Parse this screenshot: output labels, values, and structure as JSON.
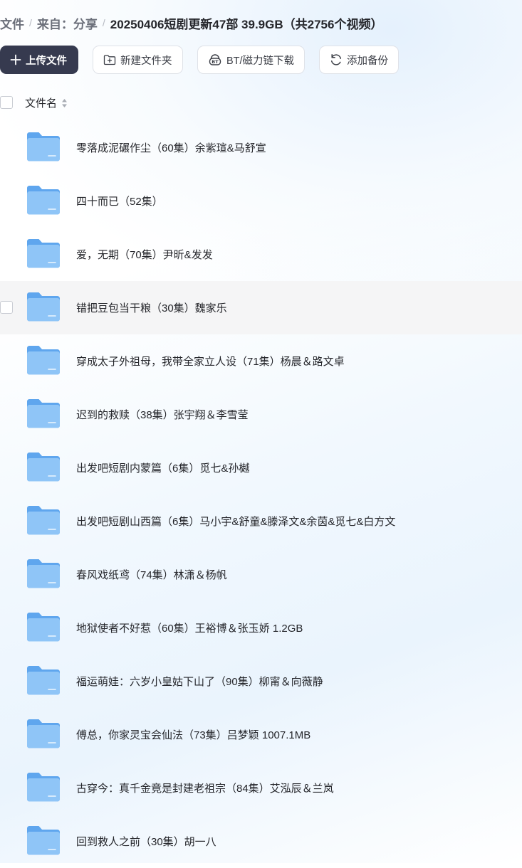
{
  "breadcrumb": {
    "root": "文件",
    "shared": "来自：分享",
    "current": "20250406短剧更新47部 39.9GB（共2756个视频）"
  },
  "toolbar": {
    "upload_label": "上传文件",
    "new_folder_label": "新建文件夹",
    "bt_download_label": "BT/磁力链下载",
    "add_backup_label": "添加备份"
  },
  "list_header": {
    "name_column": "文件名"
  },
  "files": [
    {
      "name": "零落成泥碾作尘（60集）余紫瑄&马舒宣"
    },
    {
      "name": "四十而已（52集）"
    },
    {
      "name": "爱，无期（70集）尹昕&发发"
    },
    {
      "name": "错把豆包当干粮（30集）魏家乐"
    },
    {
      "name": "穿成太子外祖母，我带全家立人设（71集）杨晨＆路文卓"
    },
    {
      "name": "迟到的救赎（38集）张宇翔＆李雪莹"
    },
    {
      "name": "出发吧短剧内蒙篇（6集）觅七&孙樾"
    },
    {
      "name": "出发吧短剧山西篇（6集）马小宇&舒童&滕泽文&余茵&觅七&白方文"
    },
    {
      "name": "春风戏纸鸢（74集）林潇＆杨帆"
    },
    {
      "name": "地狱使者不好惹（60集）王裕博＆张玉娇 1.2GB"
    },
    {
      "name": "福运萌娃：六岁小皇姑下山了（90集）柳甯＆向薇静"
    },
    {
      "name": "傅总，你家灵宝会仙法（73集）吕梦颖 1007.1MB"
    },
    {
      "name": "古穿今：真千金竟是封建老祖宗（84集）艾泓辰＆兰岚"
    },
    {
      "name": "回到救人之前（30集）胡一八"
    }
  ],
  "hovered_row_index": 3,
  "colors": {
    "primary_button": "#363a4f",
    "folder_blue": "#6aaff0",
    "hover_row": "#f5f5f6"
  }
}
